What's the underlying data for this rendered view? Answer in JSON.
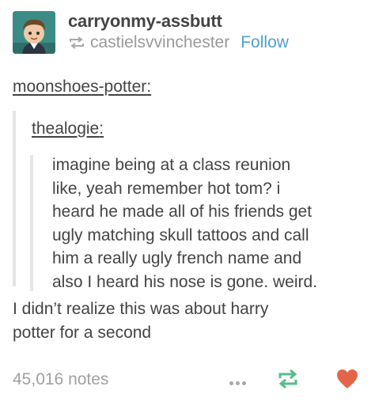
{
  "post": {
    "username": "carryonmy-assbutt",
    "reblogged_from": "castielsvvinchester",
    "follow_label": "Follow",
    "colors": {
      "accent": "#529ecc",
      "reblog_green": "#56bc8a",
      "like_red": "#e2654a"
    }
  },
  "trail": [
    {
      "username": "moonshoes-potter"
    },
    {
      "username": "thealogie"
    }
  ],
  "quote_lines": [
    "imagine being at a class reunion",
    "like, yeah remember hot tom? i",
    "heard he made all of his friends get",
    "ugly matching skull tattoos and call",
    "him a really ugly french name and",
    "also I heard his nose is gone. weird."
  ],
  "reply_lines": [
    "I didn’t realize this was about harry",
    "potter for a second"
  ],
  "footer": {
    "notes": "45,016 notes",
    "icons": [
      "more-icon",
      "reblog-icon",
      "heart-icon"
    ]
  }
}
